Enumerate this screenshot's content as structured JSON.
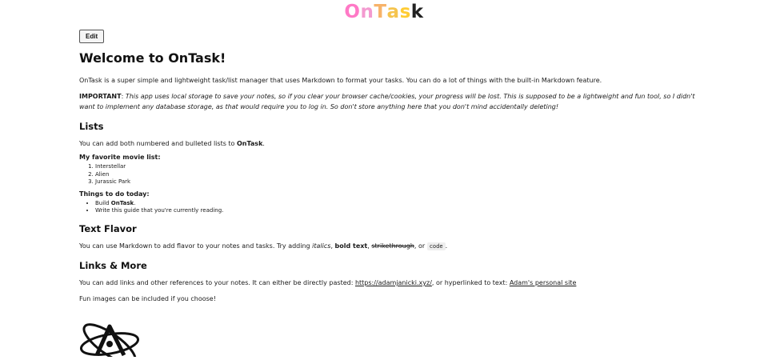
{
  "brand": {
    "letters": [
      "O",
      "n",
      "T",
      "a",
      "s",
      "k"
    ]
  },
  "edit_label": "Edit",
  "title": "Welcome to OnTask!",
  "intro": "OnTask is a super simple and lightweight task/list manager that uses Markdown to format your tasks. You can do a lot of things with the built-in Markdown feature.",
  "important": {
    "label": "IMPORTANT",
    "text": "This app uses local storage to save your notes, so if you clear your browser cache/cookies, your progress will be lost. This is supposed to be a lightweight and fun tool, so I didn't want to implement any database storage, as that would require you to log in. So don't store anything here that you don't mind accidentally deleting!"
  },
  "lists": {
    "heading": "Lists",
    "text_before": "You can add both numbered and bulleted lists to ",
    "text_bold": "OnTask",
    "text_after": ".",
    "movies_label": "My favorite movie list:",
    "movies": [
      "Interstellar",
      "Alien",
      "Jurassic Park"
    ],
    "todo_label": "Things to do today:",
    "todo_1_before": "Build ",
    "todo_1_bold": "OnTask",
    "todo_1_after": ".",
    "todo_2": "Write this guide that you're currently reading."
  },
  "flavor": {
    "heading": "Text Flavor",
    "text_before": "You can use Markdown to add flavor to your notes and tasks. Try adding ",
    "italic": "italics",
    "sep1": ", ",
    "bold": "bold text",
    "sep2": ", ",
    "strike": "strikethrough",
    "sep3": ", or ",
    "code": "code",
    "end": "."
  },
  "links": {
    "heading": "Links & More",
    "text_before": "You can add links and other references to your notes. It can either be directly pasted: ",
    "url": "https://adamjanicki.xyz/",
    "text_middle": ", or hyperlinked to text: ",
    "link_text": "Adam's personal site",
    "images_text": "Fun images can be included if you choose!"
  }
}
